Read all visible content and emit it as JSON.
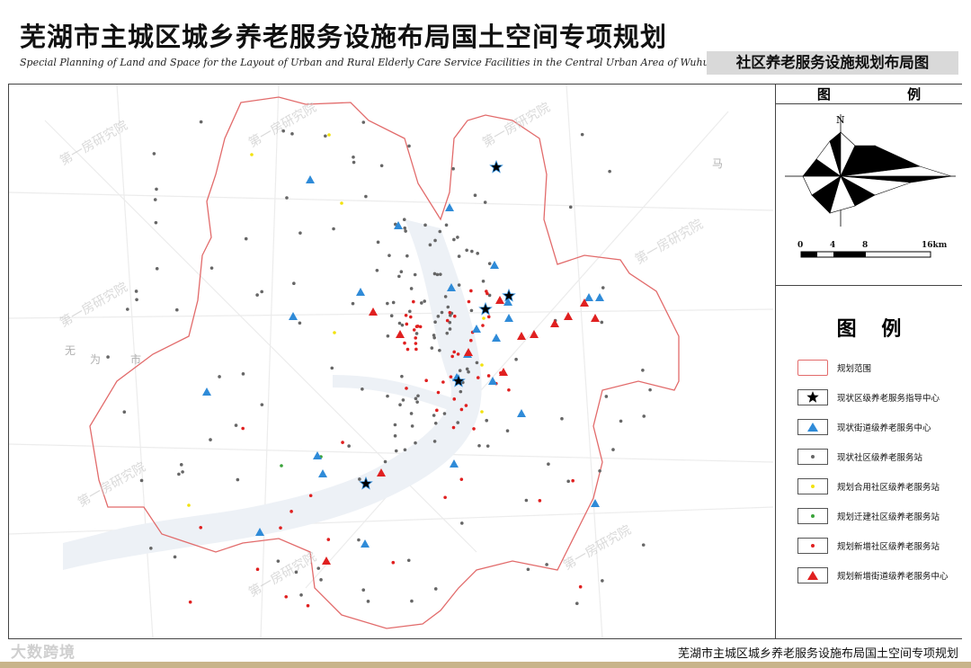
{
  "header": {
    "title": "芜湖市主城区城乡养老服务设施布局国土空间专项规划",
    "subtitle": "Special Planning of Land and Space for the Layout of Urban and Rural Elderly Care Service Facilities in the Central Urban Area of Wuhu City",
    "sheet_label": "社区养老服务设施规划布局图"
  },
  "panel": {
    "top_title": "图 例",
    "compass_north": "N",
    "scale_ticks": [
      "0",
      "4",
      "8",
      "16km"
    ],
    "legend_title": "图 例",
    "legend_items": [
      {
        "label": "规划范围",
        "symbol": "boundary",
        "color": "#e26b6b"
      },
      {
        "label": "现状区级养老服务指导中心",
        "symbol": "star",
        "color": "#000000"
      },
      {
        "label": "现状街道级养老服务中心",
        "symbol": "triangle",
        "color": "#2f8bd8"
      },
      {
        "label": "现状社区级养老服务站",
        "symbol": "dot",
        "color": "#666666"
      },
      {
        "label": "规划合用社区级养老服务站",
        "symbol": "dot",
        "color": "#f2e20f"
      },
      {
        "label": "规划迁建社区级养老服务站",
        "symbol": "dot",
        "color": "#3aa33a"
      },
      {
        "label": "规划新增社区级养老服务站",
        "symbol": "dot",
        "color": "#e02020"
      },
      {
        "label": "规划新增街道级养老服务中心",
        "symbol": "triangle",
        "color": "#e02020"
      }
    ]
  },
  "map": {
    "place_labels": [
      "无",
      "为",
      "市",
      "马"
    ],
    "watermark": "第一房研究院"
  },
  "footer": {
    "text": "芜湖市主城区城乡养老服务设施布局国土空间专项规划",
    "brand": "大数跨境"
  },
  "colors": {
    "boundary": "#e26b6b",
    "water": "#e9eef4",
    "road": "#e6e6e6",
    "footer_strip": "#c8b48a"
  }
}
